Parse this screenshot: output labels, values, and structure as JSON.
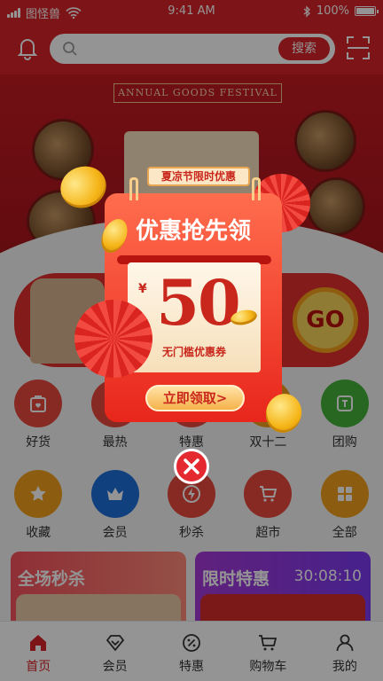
{
  "status_bar": {
    "carrier": "图怪兽",
    "time": "9:41 AM",
    "battery": "100%"
  },
  "header": {
    "search_placeholder": "",
    "search_button": "搜索"
  },
  "banner": {
    "festival_text": "ANNUAL GOODS FESTIVAL"
  },
  "categories_row1": [
    {
      "label": "好货",
      "color": "#e8493e",
      "icon": "bag-heart-icon"
    },
    {
      "label": "最热",
      "color": "#e8493e",
      "icon": "heart-icon"
    },
    {
      "label": "特惠",
      "color": "#e8493e",
      "icon": "tag-icon"
    },
    {
      "label": "双十二",
      "color": "#f2a11d",
      "icon": "gift-icon"
    },
    {
      "label": "团购",
      "color": "#46b23b",
      "icon": "group-icon"
    }
  ],
  "categories_row2": [
    {
      "label": "收藏",
      "color": "#f2a11d",
      "icon": "star-icon"
    },
    {
      "label": "会员",
      "color": "#1d6fd8",
      "icon": "crown-icon"
    },
    {
      "label": "秒杀",
      "color": "#e8493e",
      "icon": "lightning-icon"
    },
    {
      "label": "超市",
      "color": "#e8493e",
      "icon": "cart-icon"
    },
    {
      "label": "全部",
      "color": "#f2a11d",
      "icon": "grid-icon"
    }
  ],
  "cards": {
    "left_title": "全场秒杀",
    "right_title": "限时特惠",
    "right_timer": "30:08:10"
  },
  "promo": {
    "go_label": "GO"
  },
  "tabbar": [
    {
      "label": "首页",
      "icon": "home-icon",
      "active": true
    },
    {
      "label": "会员",
      "icon": "diamond-icon",
      "active": false
    },
    {
      "label": "特惠",
      "icon": "discount-icon",
      "active": false
    },
    {
      "label": "购物车",
      "icon": "cart-icon",
      "active": false
    },
    {
      "label": "我的",
      "icon": "user-icon",
      "active": false
    }
  ],
  "popup": {
    "tag": "夏凉节限时优惠",
    "title": "优惠抢先领",
    "currency": "¥",
    "amount": "50",
    "subtitle": "无门槛优惠券",
    "claim_button": "立即领取>"
  },
  "colors": {
    "brand_red": "#d8242a",
    "accent_gold": "#f5b416"
  }
}
